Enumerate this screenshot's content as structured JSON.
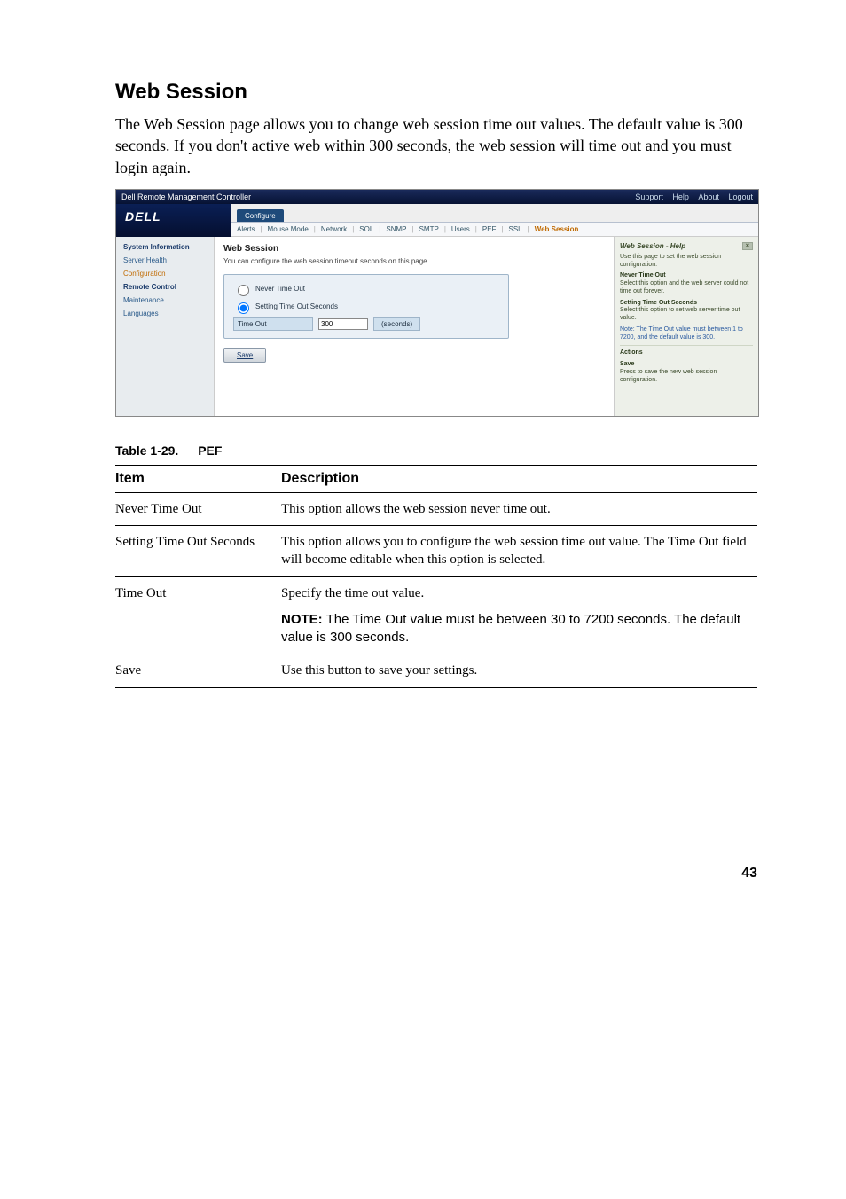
{
  "section": {
    "title": "Web Session",
    "lead": "The Web Session page allows you to change web session time out values. The default value is 300 seconds. If you don't active web within 300 seconds, the web session will time out and you must login again."
  },
  "shot": {
    "window_title": "Dell Remote Management Controller",
    "top_links": [
      "Support",
      "Help",
      "About",
      "Logout"
    ],
    "logo": "DELL",
    "primary_tabs": {
      "active": "Configure"
    },
    "sub_tabs": [
      "Alerts",
      "Mouse Mode",
      "Network",
      "SOL",
      "SNMP",
      "SMTP",
      "Users",
      "PEF",
      "SSL",
      "Web Session"
    ],
    "sub_tab_active": "Web Session",
    "leftnav": [
      {
        "label": "System Information",
        "bold": true
      },
      {
        "label": "Server Health"
      },
      {
        "label": "Configuration",
        "selected": true
      },
      {
        "label": "Remote Control",
        "bold": true
      },
      {
        "label": "Maintenance"
      },
      {
        "label": "Languages"
      }
    ],
    "center": {
      "heading": "Web Session",
      "desc": "You can configure the web session timeout seconds on this page.",
      "opt_never": "Never Time Out",
      "opt_setting": "Setting Time Out Seconds",
      "timeout_label": "Time Out",
      "timeout_value": "300",
      "timeout_unit": "(seconds)",
      "save": "Save"
    },
    "help": {
      "title": "Web Session - Help",
      "intro": "Use this page to set the web session configuration.",
      "never_h": "Never Time Out",
      "never_b": "Select this option and the web server could not time out forever.",
      "setting_h": "Setting Time Out Seconds",
      "setting_b": "Select this option to set web server time out value.",
      "note": "Note: The Time Out value must between 1 to 7200, and the default value is 300.",
      "actions_h": "Actions",
      "save_h": "Save",
      "save_b": "Press to save the new web session configuration."
    }
  },
  "table": {
    "caption_num": "Table 1-29.",
    "caption_title": "PEF",
    "head_item": "Item",
    "head_desc": "Description",
    "rows": [
      {
        "item": "Never Time Out",
        "desc": "This option allows the web session never time out."
      },
      {
        "item": "Setting Time Out Seconds",
        "desc": "This option allows you to configure the web session time out value. The Time Out field will become editable when this option is selected."
      },
      {
        "item": "Time Out",
        "desc": "Specify the time out value."
      },
      {
        "item": "",
        "desc_note_label": "NOTE:",
        "desc_note": " The Time Out value must be between 30 to 7200 seconds. The default value is 300 seconds."
      },
      {
        "item": "Save",
        "desc": "Use this button to save your settings."
      }
    ]
  },
  "page_number": "43"
}
